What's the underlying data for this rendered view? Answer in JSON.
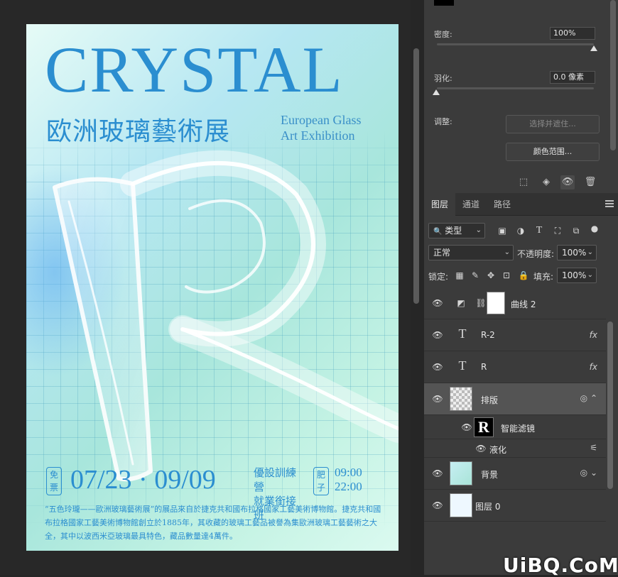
{
  "poster": {
    "title": "CRYSTAL",
    "subtitle_cn": "欧洲玻璃藝術展",
    "subtitle_en_line1": "European Glass",
    "subtitle_en_line2": "Art Exhibition",
    "letter": "R",
    "free_tag": "免票",
    "dates": "07/23 · 09/09",
    "camp_line1": "優設訓練營",
    "camp_line2": "就業銜接班",
    "v_tag": "肥子",
    "time1": "09:00",
    "time2": "22:00",
    "paragraph": "“五色玲瓏——歐洲玻璃藝術展”的展品來自於捷克共和國布拉格國家工藝美術博物館。捷克共和國布拉格國家工藝美術博物館創立於1885年，其收藏的玻璃工藝品被譽為集歐洲玻璃工藝藝術之大全，其中以波西米亞玻璃最具特色，藏品數量達4萬件。",
    "colors": {
      "ink": "#2b8ed0",
      "bg_mint": "#a8e6dc",
      "bg_blue": "#b6e7f2"
    }
  },
  "properties": {
    "density_label": "密度:",
    "density_value": "100%",
    "density_level": 1.0,
    "feather_label": "羽化:",
    "feather_value": "0.0 像素",
    "feather_level": 0.0,
    "adjust_label": "调整:",
    "select_mask_button": "选择并遮住...",
    "color_range_button": "颜色范围..."
  },
  "tabs": [
    {
      "label": "图层",
      "active": true
    },
    {
      "label": "通道",
      "active": false
    },
    {
      "label": "路径",
      "active": false
    }
  ],
  "layers_toolbar": {
    "filter_kind": "类型",
    "blend_mode": "正常",
    "opacity_label": "不透明度:",
    "opacity_value": "100%",
    "lock_label": "锁定:",
    "fill_label": "填充:",
    "fill_value": "100%"
  },
  "layers": [
    {
      "name": "曲线 2",
      "kind": "adjustment-curves"
    },
    {
      "name": "R-2",
      "kind": "text",
      "fx": "fx"
    },
    {
      "name": "R",
      "kind": "text",
      "fx": "fx"
    },
    {
      "name": "排版",
      "kind": "smart-object",
      "selected": true
    },
    {
      "name": "智能滤镜",
      "kind": "smart-filter-mask"
    },
    {
      "name": "液化",
      "kind": "filter"
    },
    {
      "name": "背景",
      "kind": "smart-object"
    },
    {
      "name": "图层 0",
      "kind": "pixel"
    }
  ],
  "watermark": "UiBQ.CoM"
}
